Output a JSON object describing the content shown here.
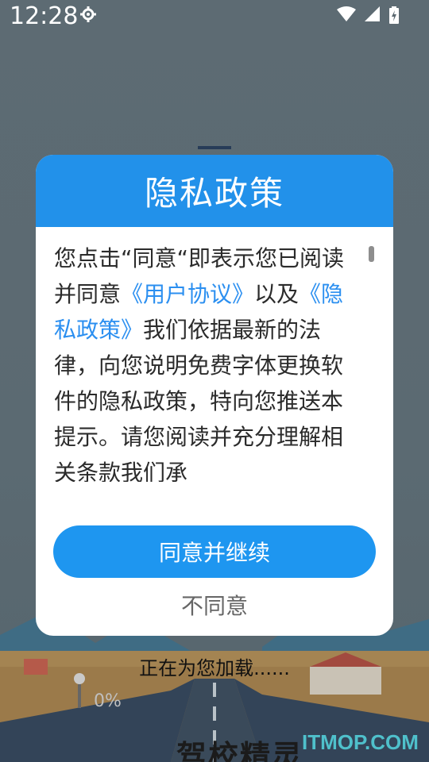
{
  "status_bar": {
    "time": "12:28"
  },
  "dialog": {
    "title": "隐私政策",
    "body": {
      "intro": "您点击“同意“即表示您已阅读并同意",
      "user_agreement_link": "《用户协议》",
      "and_text": "以及",
      "privacy_link": "《隐私政策》",
      "rest": "我们依据最新的法律，向您说明免费字体更换软件的隐私政策，特向您推送本提示。请您阅读并充分理解相关条款我们承"
    },
    "agree_label": "同意并继续",
    "disagree_label": "不同意"
  },
  "background": {
    "loading_text": "正在为您加载......",
    "brand_title": "驾校精灵",
    "watermark": "ITMOP.COM",
    "percent_label": "0%"
  },
  "colors": {
    "accent": "#2291ea",
    "button": "#1e96f0",
    "link": "#2b8ff0"
  }
}
